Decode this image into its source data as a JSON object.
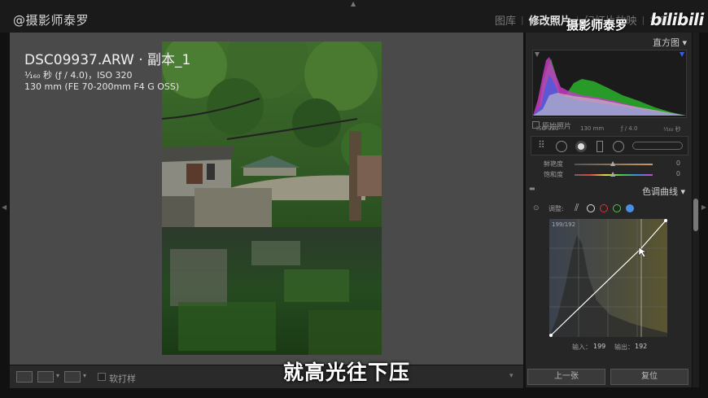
{
  "watermark": "@摄影师泰罗",
  "modules": [
    {
      "label": "图库",
      "active": false
    },
    {
      "label": "修改照片",
      "active": true
    },
    {
      "label": "幻灯片放映",
      "active": false
    },
    {
      "label": "打印",
      "active": false
    }
  ],
  "brand": {
    "name": "摄影师泰罗",
    "logo": "bilibili"
  },
  "photo_info": {
    "title": "DSC09937.ARW · 副本_1",
    "exposure": "¹⁄₁₆₀ 秒 (ƒ / 4.0)，ISO 320",
    "lens": "130 mm (FE 70-200mm F4 G OSS)"
  },
  "toolbar": {
    "soft_proof_label": "软打样"
  },
  "subtitle": "就高光往下压",
  "panel": {
    "histogram_title": "直方图",
    "hist_meta": [
      "ISO 320",
      "130 mm",
      "ƒ / 4.0",
      "¹⁄₁₆₀ 秒"
    ],
    "original_photo_label": "原始照片",
    "sliders": [
      {
        "label": "鲜艳度",
        "value": "0"
      },
      {
        "label": "饱和度",
        "value": "0"
      }
    ],
    "tone_curve_title": "色调曲线",
    "adjust_label": "调整:",
    "curve_readout": "199/192",
    "input_label": "输入：",
    "input_value": "199",
    "output_label": "输出：",
    "output_value": "192",
    "prev_button": "上一张",
    "reset_button": "复位"
  },
  "colors": {
    "accent_blue": "#4a8ee6",
    "red": "#d33",
    "green": "#4c4",
    "panel_bg": "#262626"
  }
}
